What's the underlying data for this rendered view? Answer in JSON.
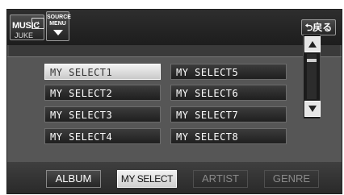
{
  "header": {
    "source_button": {
      "line1": "MUSIC",
      "line2": "JUKE",
      "icon": "music-note-icon"
    },
    "source_menu": {
      "line1": "SOURCE",
      "line2": "MENU",
      "icon": "chevron-down-icon"
    },
    "back_label": "⮌戻る"
  },
  "list": {
    "items": [
      {
        "label": "MY SELECT1",
        "selected": true
      },
      {
        "label": "MY SELECT2",
        "selected": false
      },
      {
        "label": "MY SELECT3",
        "selected": false
      },
      {
        "label": "MY SELECT4",
        "selected": false
      },
      {
        "label": "MY SELECT5",
        "selected": false
      },
      {
        "label": "MY SELECT6",
        "selected": false
      },
      {
        "label": "MY SELECT7",
        "selected": false
      },
      {
        "label": "MY SELECT8",
        "selected": false
      }
    ]
  },
  "scrollbar": {
    "up_icon": "arrow-up-icon",
    "down_icon": "arrow-down-icon"
  },
  "tabs": [
    {
      "label": "ALBUM",
      "state": "enabled"
    },
    {
      "label": "MY SELECT",
      "state": "active"
    },
    {
      "label": "ARTIST",
      "state": "disabled"
    },
    {
      "label": "GENRE",
      "state": "disabled"
    }
  ]
}
